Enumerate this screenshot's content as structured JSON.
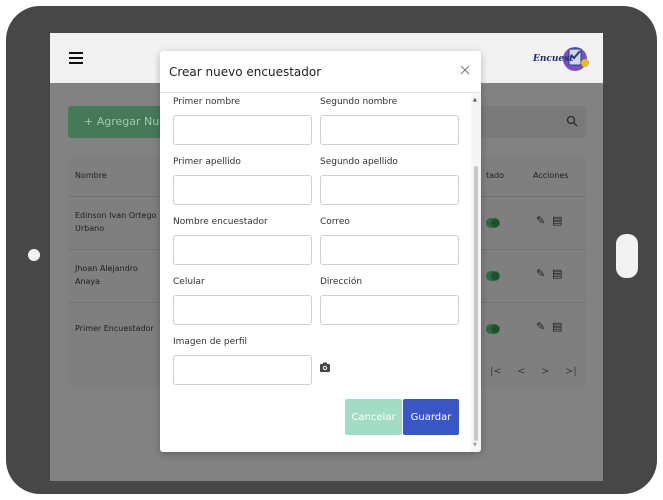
{
  "header": {
    "logo_text": "Encuest"
  },
  "toolbar": {
    "add_label": "+ Agregar Nuevo",
    "search_icon": "search-icon"
  },
  "table": {
    "columns": [
      "Nombre",
      "tado",
      "Acciones"
    ],
    "rows": [
      {
        "name": "Edinson Ivan Ortego Urbano"
      },
      {
        "name": "Jhoan Alejandro Anaya"
      },
      {
        "name": "Primer Encuestador"
      }
    ],
    "pager": {
      "first": "|<",
      "prev": "<",
      "next": ">",
      "last": ">|"
    }
  },
  "modal": {
    "title": "Crear nuevo encuestador",
    "close_label": "X",
    "fields": {
      "primer_nombre": {
        "label": "Primer nombre",
        "value": ""
      },
      "segundo_nombre": {
        "label": "Segundo nombre",
        "value": ""
      },
      "primer_apellido": {
        "label": "Primer apellido",
        "value": ""
      },
      "segundo_apellido": {
        "label": "Segundo apellido",
        "value": ""
      },
      "nombre_encuestador": {
        "label": "Nombre encuestador",
        "value": ""
      },
      "correo": {
        "label": "Correo",
        "value": ""
      },
      "celular": {
        "label": "Celular",
        "value": ""
      },
      "direccion": {
        "label": "Dirección",
        "value": ""
      },
      "imagen": {
        "label": "Imagen de perfil",
        "value": ""
      }
    },
    "cancel_label": "Cancelar",
    "save_label": "Guardar"
  },
  "colors": {
    "frame": "#474747",
    "overlay": "#828282",
    "cancel": "#a3dcc4",
    "save": "#3a55c4"
  }
}
